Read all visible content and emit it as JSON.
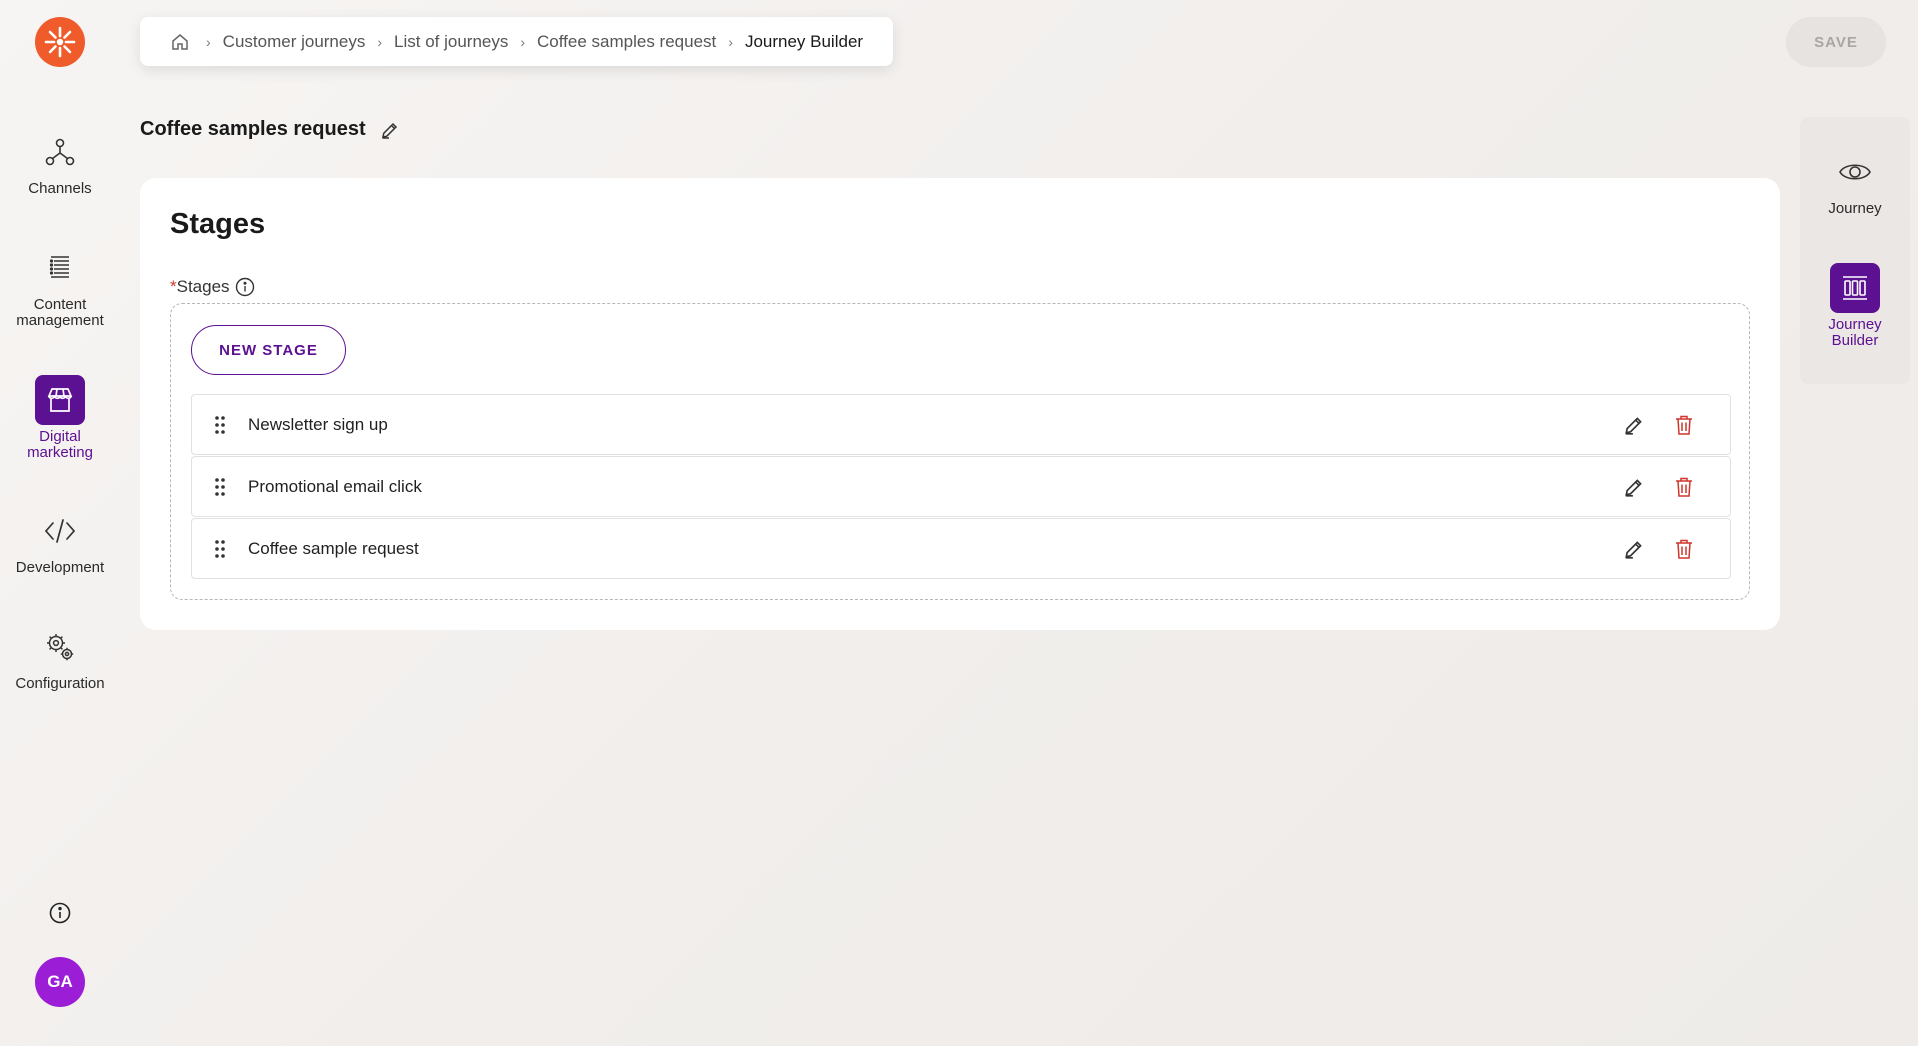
{
  "sidebar": {
    "logo": "brand-logo",
    "items": [
      {
        "label": "Channels",
        "icon": "channels-icon"
      },
      {
        "label": "Content management",
        "icon": "content-icon"
      },
      {
        "label": "Digital marketing",
        "icon": "storefront-icon",
        "active": true
      },
      {
        "label": "Development",
        "icon": "code-icon"
      },
      {
        "label": "Configuration",
        "icon": "gears-icon"
      }
    ],
    "avatar_initials": "GA"
  },
  "breadcrumb": {
    "items": [
      "Customer journeys",
      "List of journeys",
      "Coffee samples request",
      "Journey Builder"
    ]
  },
  "toolbar": {
    "save_label": "SAVE"
  },
  "page": {
    "title": "Coffee samples request"
  },
  "stages_card": {
    "heading": "Stages",
    "field_required_mark": "*",
    "field_label": "Stages",
    "new_stage_label": "NEW STAGE",
    "stages": [
      {
        "name": "Newsletter sign up"
      },
      {
        "name": "Promotional email click"
      },
      {
        "name": "Coffee sample request"
      }
    ]
  },
  "right_panel": {
    "items": [
      {
        "label": "Journey",
        "icon": "eye-icon"
      },
      {
        "label": "Journey Builder",
        "icon": "builder-icon",
        "active": true
      }
    ]
  },
  "colors": {
    "brand_purple": "#5c1092",
    "logo_orange": "#ef5b2a",
    "avatar_purple": "#9b1ed6",
    "delete_red": "#d0342c"
  }
}
